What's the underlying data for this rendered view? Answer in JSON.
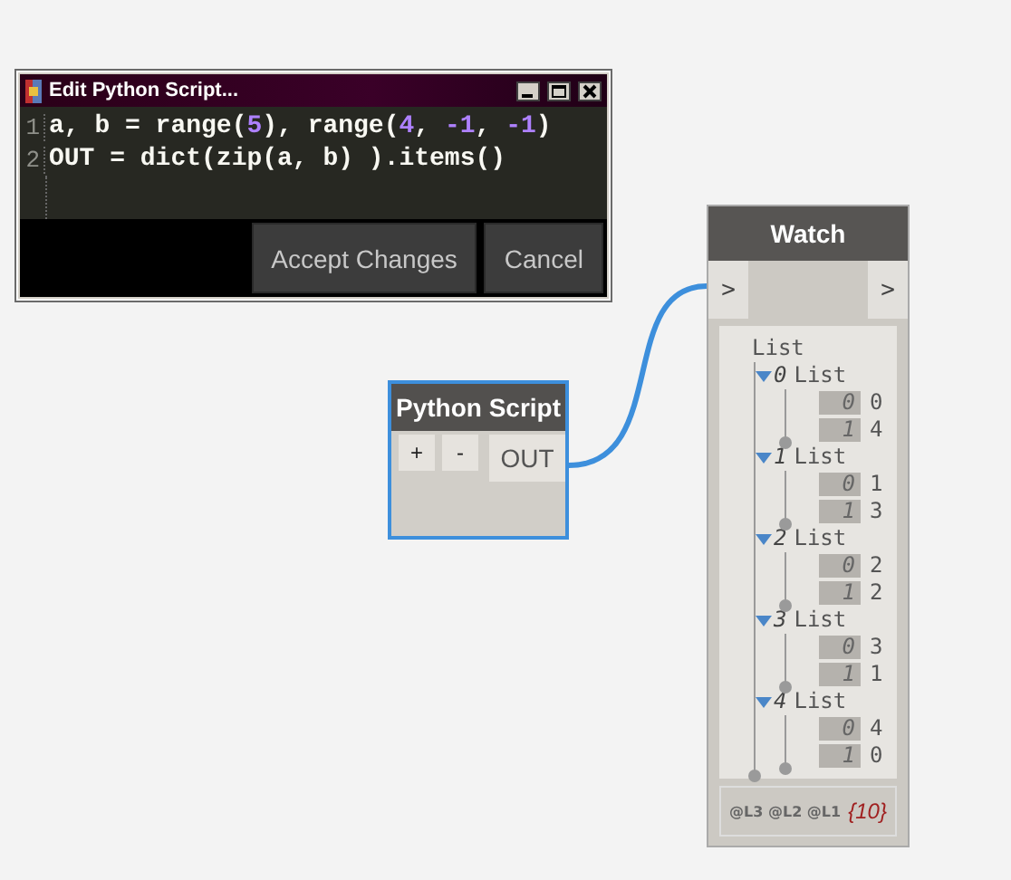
{
  "editor": {
    "title": "Edit Python Script...",
    "lines": [
      {
        "number": "1",
        "tokens": [
          {
            "kind": "plain",
            "text": "a, b = range("
          },
          {
            "kind": "number",
            "text": "5"
          },
          {
            "kind": "plain",
            "text": "), range("
          },
          {
            "kind": "number",
            "text": "4"
          },
          {
            "kind": "plain",
            "text": ", "
          },
          {
            "kind": "number",
            "text": "-1"
          },
          {
            "kind": "plain",
            "text": ", "
          },
          {
            "kind": "number",
            "text": "-1"
          },
          {
            "kind": "plain",
            "text": ")"
          }
        ]
      },
      {
        "number": "2",
        "tokens": [
          {
            "kind": "plain",
            "text": "OUT = dict(zip(a, b) ).items()"
          }
        ]
      }
    ],
    "buttons": [
      "Accept Changes",
      "Cancel"
    ]
  },
  "python_node": {
    "title": "Python Script",
    "buttons": [
      "+",
      "-"
    ],
    "output_port": "OUT",
    "selected": true
  },
  "watch_node": {
    "title": "Watch",
    "input_port": ">",
    "output_port": ">",
    "tree": {
      "label": "List",
      "children": [
        {
          "index": "0",
          "label": "List",
          "expanded": true,
          "items": [
            {
              "index": "0",
              "value": "0"
            },
            {
              "index": "1",
              "value": "4"
            }
          ]
        },
        {
          "index": "1",
          "label": "List",
          "expanded": true,
          "items": [
            {
              "index": "0",
              "value": "1"
            },
            {
              "index": "1",
              "value": "3"
            }
          ]
        },
        {
          "index": "2",
          "label": "List",
          "expanded": true,
          "items": [
            {
              "index": "0",
              "value": "2"
            },
            {
              "index": "1",
              "value": "2"
            }
          ]
        },
        {
          "index": "3",
          "label": "List",
          "expanded": true,
          "items": [
            {
              "index": "0",
              "value": "3"
            },
            {
              "index": "1",
              "value": "1"
            }
          ]
        },
        {
          "index": "4",
          "label": "List",
          "expanded": true,
          "items": [
            {
              "index": "0",
              "value": "4"
            },
            {
              "index": "1",
              "value": "0"
            }
          ]
        }
      ]
    },
    "levels": [
      "@L3",
      "@L2",
      "@L1"
    ],
    "count": "{10}"
  }
}
